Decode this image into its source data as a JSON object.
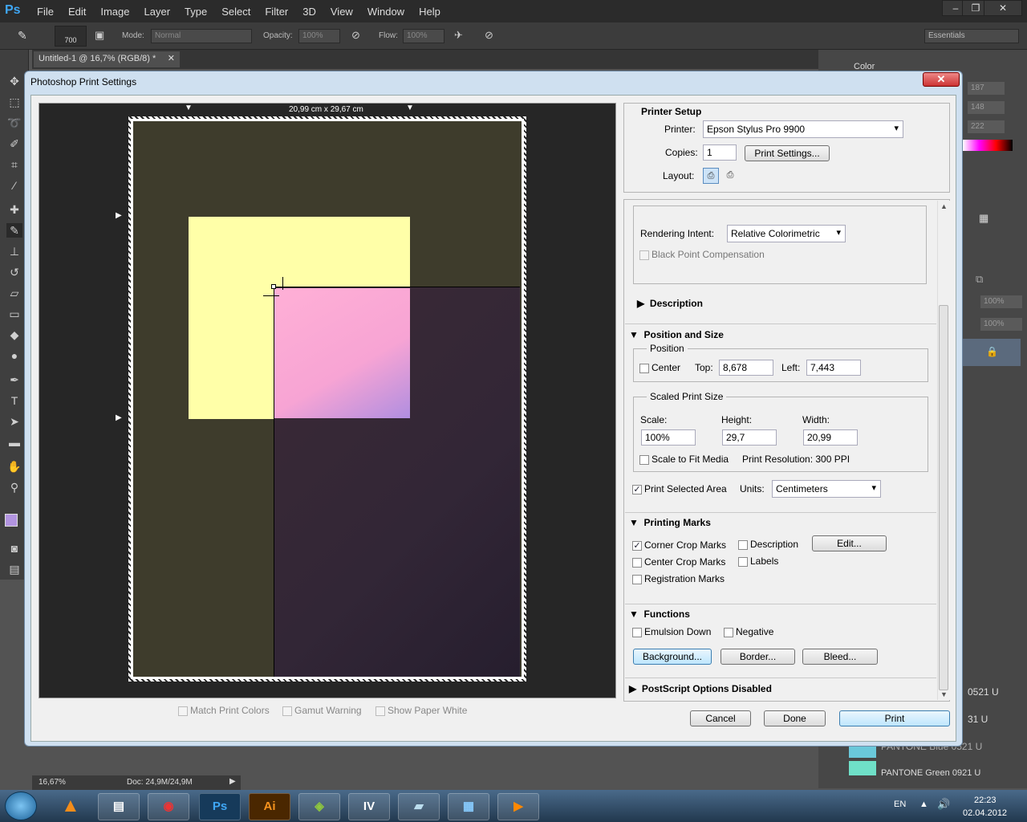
{
  "app": {
    "logo": "Ps",
    "menu": [
      "File",
      "Edit",
      "Image",
      "Layer",
      "Type",
      "Select",
      "Filter",
      "3D",
      "View",
      "Window",
      "Help"
    ],
    "workspace": "Essentials"
  },
  "options_bar": {
    "brush_size": "700",
    "mode_label": "Mode:",
    "mode_value": "Normal",
    "opacity_label": "Opacity:",
    "opacity_value": "100%",
    "flow_label": "Flow:",
    "flow_value": "100%"
  },
  "document": {
    "tab_title": "Untitled-1 @ 16,7% (RGB/8) *",
    "zoom": "16,67%",
    "doc_info": "Doc: 24,9M/24,9M"
  },
  "right_panel": {
    "color_tab": "Color",
    "rgb_values": [
      "187",
      "148",
      "222"
    ],
    "opacity_value": "100%",
    "fill_value": "100%",
    "swatches": [
      "0521 U",
      "31 U",
      "PANTONE Blue 0521 U",
      "PANTONE Green 0921 U"
    ]
  },
  "dialog": {
    "title": "Photoshop Print Settings",
    "paper_size": "20,99 cm x 29,67 cm",
    "preview_options": [
      {
        "label": "Match Print Colors",
        "checked": false
      },
      {
        "label": "Gamut Warning",
        "checked": false
      },
      {
        "label": "Show Paper White",
        "checked": false
      }
    ],
    "printer_setup": {
      "heading": "Printer Setup",
      "printer_label": "Printer:",
      "printer_value": "Epson Stylus Pro 9900",
      "copies_label": "Copies:",
      "copies_value": "1",
      "print_settings_button": "Print Settings...",
      "layout_label": "Layout:"
    },
    "color_management": {
      "rendering_intent_label": "Rendering Intent:",
      "rendering_intent_value": "Relative Colorimetric",
      "black_point_label": "Black Point Compensation"
    },
    "description_section": "Description",
    "position_and_size": {
      "heading": "Position and Size",
      "position_group": "Position",
      "center_label": "Center",
      "top_label": "Top:",
      "top_value": "8,678",
      "left_label": "Left:",
      "left_value": "7,443",
      "scaled_group": "Scaled Print Size",
      "scale_label": "Scale:",
      "scale_value": "100%",
      "height_label": "Height:",
      "height_value": "29,7",
      "width_label": "Width:",
      "width_value": "20,99",
      "scale_to_fit_label": "Scale to Fit Media",
      "print_resolution": "Print Resolution: 300 PPI",
      "print_selected_label": "Print Selected Area",
      "units_label": "Units:",
      "units_value": "Centimeters"
    },
    "printing_marks": {
      "heading": "Printing Marks",
      "corner_crop": "Corner Crop Marks",
      "center_crop": "Center Crop Marks",
      "registration": "Registration Marks",
      "description": "Description",
      "labels": "Labels",
      "edit_button": "Edit..."
    },
    "functions": {
      "heading": "Functions",
      "emulsion_down": "Emulsion Down",
      "negative": "Negative",
      "background_button": "Background...",
      "border_button": "Border...",
      "bleed_button": "Bleed..."
    },
    "postscript": "PostScript Options Disabled",
    "buttons": {
      "cancel": "Cancel",
      "done": "Done",
      "print": "Print"
    }
  },
  "taskbar": {
    "apps": [
      "VLC",
      "Chrome",
      "Ps",
      "Ai",
      "Alt",
      "IV",
      "Note",
      "Net",
      "Play"
    ],
    "language": "EN",
    "time": "22:23",
    "date": "02.04.2012"
  }
}
